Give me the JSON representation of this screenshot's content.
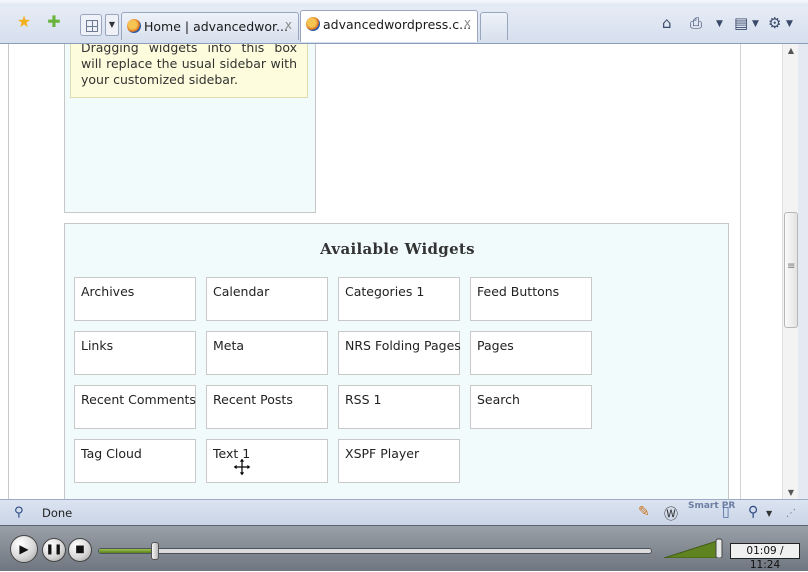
{
  "browser": {
    "tabs": [
      {
        "label": "Home | advancedwor...",
        "close": "x"
      },
      {
        "label": "advancedwordpress.c...",
        "close": "x"
      }
    ],
    "icons": [
      "bookmark-star-icon",
      "add-bookmark-icon",
      "tab-grid-icon",
      "home-icon",
      "print-icon",
      "page-icon",
      "tools-gear-icon"
    ]
  },
  "page": {
    "sidebar_note": "Dragging widgets into this box will replace the usual sidebar with your customized sidebar.",
    "panel_title": "Available Widgets",
    "widgets": [
      "Archives",
      "Calendar",
      "Categories 1",
      "Feed Buttons",
      "Links",
      "Meta",
      "NRS Folding Pages",
      "Pages",
      "Recent Comments",
      "Recent Posts",
      "RSS 1",
      "Search",
      "Tag Cloud",
      "Text 1",
      "XSPF Player"
    ]
  },
  "status_bar": {
    "text": "Done",
    "smartpr": "Smart PR"
  },
  "player": {
    "time": "01:09 / 11:24",
    "progress": 0.101,
    "volume_level": 0.9
  }
}
